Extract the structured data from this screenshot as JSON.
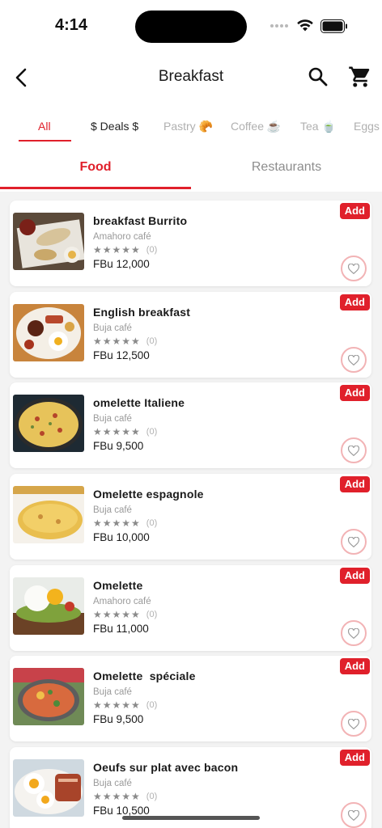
{
  "status_bar": {
    "time": "4:14"
  },
  "header": {
    "title": "Breakfast"
  },
  "categories": [
    {
      "label": "All",
      "active": true
    },
    {
      "label": "$ Deals $",
      "active": false
    },
    {
      "label": "Pastry 🥐",
      "active": false
    },
    {
      "label": "Coffee ☕",
      "active": false
    },
    {
      "label": "Tea 🍵",
      "active": false
    },
    {
      "label": "Eggs",
      "active": false
    }
  ],
  "tabs": {
    "food": "Food",
    "restaurants": "Restaurants"
  },
  "add_label": "Add",
  "items": [
    {
      "name": "breakfast Burrito",
      "restaurant": "Amahoro café",
      "stars": "★★★★★",
      "count": "(0)",
      "price": "FBu 12,000"
    },
    {
      "name": "English breakfast",
      "restaurant": "Buja café",
      "stars": "★★★★★",
      "count": "(0)",
      "price": "FBu 12,500"
    },
    {
      "name": "omelette Italiene",
      "restaurant": "Buja café",
      "stars": "★★★★★",
      "count": "(0)",
      "price": "FBu 9,500"
    },
    {
      "name": "Omelette espagnole",
      "restaurant": "Buja café",
      "stars": "★★★★★",
      "count": "(0)",
      "price": "FBu 10,000"
    },
    {
      "name": "Omelette",
      "restaurant": "Amahoro café",
      "stars": "★★★★★",
      "count": "(0)",
      "price": "FBu 11,000"
    },
    {
      "name": "Omelette  spéciale",
      "restaurant": "Buja café",
      "stars": "★★★★★",
      "count": "(0)",
      "price": "FBu 9,500"
    },
    {
      "name": "Oeufs sur plat avec bacon",
      "restaurant": "Buja café",
      "stars": "★★★★★",
      "count": "(0)",
      "price": "FBu 10,500"
    }
  ],
  "colors": {
    "accent": "#e0202b",
    "background": "#f3f3f3"
  }
}
